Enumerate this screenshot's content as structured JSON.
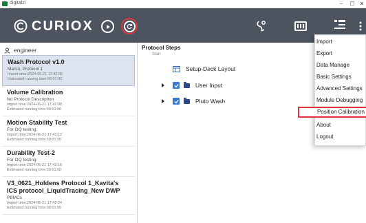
{
  "window": {
    "title": "digitalzi",
    "controls": {
      "minimize": "–",
      "maximize": "☐",
      "close": "✕"
    }
  },
  "header": {
    "logo_text": "CURIOX",
    "buttons": [
      "play-icon",
      "sync-icon",
      "usb-icon",
      "plate-icon",
      "menu-icon",
      "more-icon"
    ],
    "accent_color": "#e0343b",
    "background_color": "#4d5460"
  },
  "user": {
    "name": "engineer"
  },
  "protocols": [
    {
      "name": "Wash Protocol v1.0",
      "desc": "Marco, Protocol 1",
      "import": "Import time:2024-06-21 17:42:05",
      "runtime": "Estimated running time:00:01:00",
      "selected": true
    },
    {
      "name": "Volume Calibration",
      "desc": "No Protocol Description",
      "import": "Import time:2024-06-21 17:42:08",
      "runtime": "Estimated running time:00:01:00"
    },
    {
      "name": "Motion Stability Test",
      "desc": "For OQ testing",
      "import": "Import time:2024-06-21 17:42:12",
      "runtime": "Estimated running time:00:01:00"
    },
    {
      "name": "Durability Test-2",
      "desc": "For OQ testing",
      "import": "Import time:2024-06-21 17:42:16",
      "runtime": "Estimated running time:00:01:00"
    },
    {
      "name": "V3_0621_Holdens Protocol 1_Kavita's ICS protocol_LiquidTracing_New DWP",
      "desc": "PBMCs",
      "import": "Import time:2024-06-21 17:42:24",
      "runtime": "Estimated running time:00:01:00"
    }
  ],
  "steps": {
    "title": "Protocol Steps",
    "start": "Start",
    "items": [
      {
        "label": "Setup-Deck Layout"
      },
      {
        "label": "User Input"
      },
      {
        "label": "Pluto Wash"
      }
    ]
  },
  "menu": {
    "items": [
      {
        "label": "Import"
      },
      {
        "label": "Export"
      },
      {
        "label": "Data Manage"
      },
      {
        "label": "Basic Settings"
      },
      {
        "label": "Advanced Settings"
      },
      {
        "label": "Module Debugging"
      },
      {
        "label": "Position Calibration",
        "highlighted": true
      },
      {
        "label": "About"
      },
      {
        "label": "Logout"
      }
    ]
  }
}
